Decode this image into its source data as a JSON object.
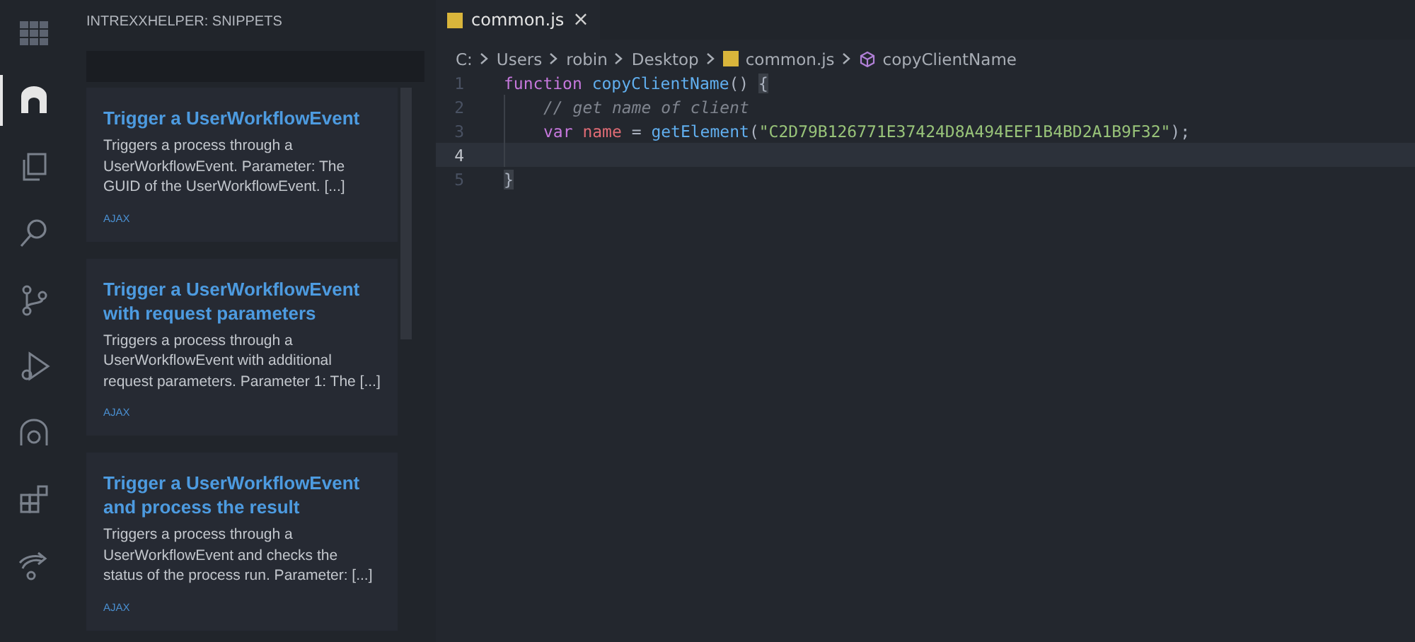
{
  "activity_bar": {
    "items": [
      {
        "kind": "grid",
        "selected": false
      },
      {
        "kind": "arch",
        "selected": true
      },
      {
        "kind": "files",
        "selected": false
      },
      {
        "kind": "search",
        "selected": false
      },
      {
        "kind": "branch",
        "selected": false
      },
      {
        "kind": "debug",
        "selected": false
      },
      {
        "kind": "remote",
        "selected": false
      },
      {
        "kind": "extensions",
        "selected": false
      },
      {
        "kind": "share",
        "selected": false
      }
    ]
  },
  "sidebar": {
    "title": "INTREXXHELPER: SNIPPETS",
    "snippets": [
      {
        "title": "Trigger a UserWorkflowEvent",
        "description": "Triggers a process through a UserWorkflowEvent. Parameter: The GUID of the UserWorkflowEvent. [...]",
        "tag": "AJAX"
      },
      {
        "title": "Trigger a UserWorkflowEvent with request parameters",
        "description": "Triggers a process through a UserWorkflowEvent with additional request parameters. Parameter 1: The [...]",
        "tag": "AJAX"
      },
      {
        "title": "Trigger a UserWorkflowEvent and process the result",
        "description": "Triggers a process through a UserWorkflowEvent and checks the status of the process run. Parameter: [...]",
        "tag": "AJAX"
      }
    ]
  },
  "tabs": [
    {
      "label": "common.js",
      "selected": true,
      "close": "×"
    }
  ],
  "breadcrumbs": [
    {
      "label": "C:",
      "kind": "text"
    },
    {
      "label": "Users",
      "kind": "text"
    },
    {
      "label": "robin",
      "kind": "text"
    },
    {
      "label": "Desktop",
      "kind": "text"
    },
    {
      "label": "common.js",
      "kind": "file"
    },
    {
      "label": "copyClientName",
      "kind": "symbol"
    }
  ],
  "editor": {
    "lines": [
      {
        "number": "1",
        "current": false,
        "tokens": [
          {
            "text": "function",
            "kind": "keyword"
          },
          {
            "text": "copyClientName",
            "kind": "function"
          },
          {
            "text": "()",
            "kind": "plain"
          },
          {
            "text": "{",
            "kind": "bracket"
          }
        ],
        "children": [
          {
            "number": "2",
            "current": false,
            "tokens": [
              {
                "text": "// get name of client",
                "kind": "comment"
              }
            ]
          },
          {
            "number": "3",
            "current": false,
            "tokens": [
              {
                "text": "var",
                "kind": "keyword"
              },
              {
                "text": "name",
                "kind": "variable"
              },
              {
                "text": " = ",
                "kind": "plain"
              },
              {
                "text": "getElement",
                "kind": "function"
              },
              {
                "text": "(",
                "kind": "plain"
              },
              {
                "text": "\"C2D79B126771E37424D8A494EEF1B4BD2A1B9F32\"",
                "kind": "string"
              },
              {
                "text": ");",
                "kind": "plain"
              }
            ]
          },
          {
            "number": "4",
            "current": true
          }
        ]
      },
      {
        "number": "5",
        "current": false,
        "tokens": [
          {
            "text": "}",
            "kind": "bracket"
          }
        ]
      }
    ]
  }
}
